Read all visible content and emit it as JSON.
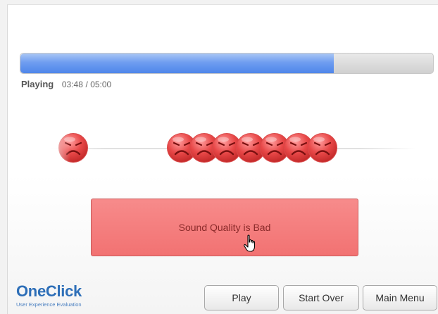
{
  "player": {
    "progress": 0.76,
    "state": "Playing",
    "current_time": "03:48",
    "total_time": "/ 05:00"
  },
  "faces": {
    "icon": "sad-face-icon",
    "color": "#e84848",
    "count_in_cluster": 7
  },
  "rating": {
    "label": "Sound Quality is Bad",
    "color": "#f27272"
  },
  "brand": {
    "name": "OneClick",
    "tagline": "User Experience Evaluation"
  },
  "controls": {
    "play_label": "Play",
    "start_over_label": "Start Over",
    "main_menu_label": "Main Menu"
  }
}
